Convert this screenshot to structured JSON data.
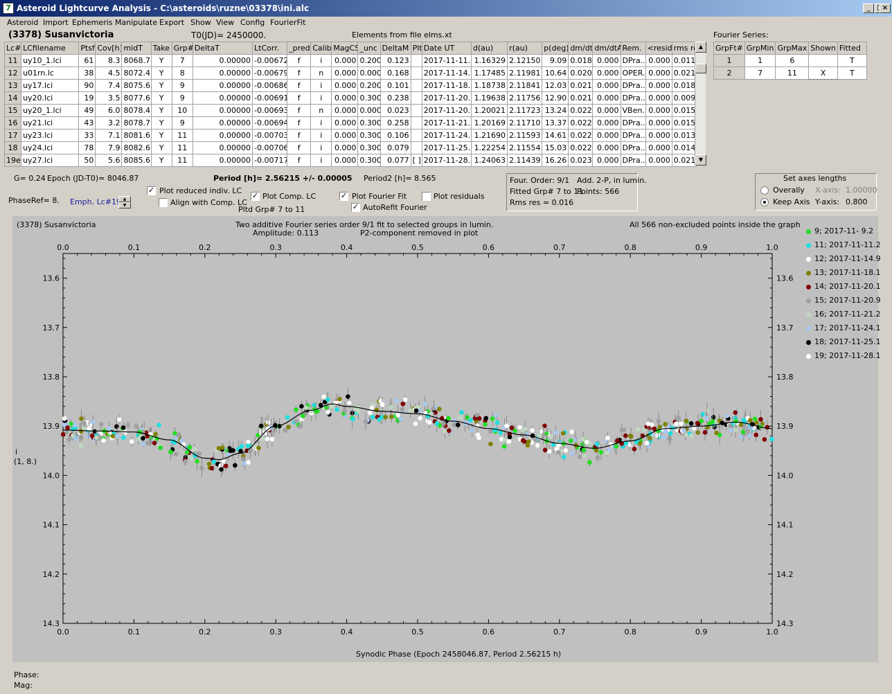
{
  "window": {
    "title": "Asteroid Lightcurve Analysis - C:\\asteroids\\ruzne\\03378\\ini.alc",
    "min_label": "_",
    "max_label": "□",
    "close_label": "×"
  },
  "menu": [
    "Asteroid",
    "Import",
    "Ephemeris",
    "Manipulate",
    "Export",
    "Show",
    "View",
    "Config",
    "FourierFit"
  ],
  "header": {
    "asteroid_name": "(3378) Susanvictoria",
    "t0": "T0(JD)= 2450000.",
    "elements_source": "Elements from file elms.xt",
    "fourier_series_label": "Fourier Series:"
  },
  "lc_table": {
    "columns": [
      "Lc#",
      "LCfilename",
      "Ptsf",
      "Cov[h]",
      "midT",
      "Take",
      "Grp#",
      "DeltaT",
      "LtCorr.",
      "_pred.",
      "Calib.",
      "MagCS",
      "_unc",
      "DeltaM",
      "Plt",
      "Date UT",
      "d(au)",
      "r(au)",
      "p(deg)",
      "dm/dt",
      "dm/dtA",
      "Rem.",
      "<resid>",
      "rms res"
    ],
    "rows": [
      [
        "11",
        "uy10_1.lci",
        "61",
        "8.3",
        "8068.7",
        "Y",
        "7",
        "0.00000",
        "-0.00672",
        "f",
        "i",
        "0.000",
        "0.200",
        "0.123",
        "",
        "2017-11-11.2",
        "1.16329",
        "2.12150",
        "9.09",
        "0.018",
        "0.000",
        "DPra...",
        "0.000",
        "0.011"
      ],
      [
        "12",
        "u01rn.lc",
        "38",
        "4.5",
        "8072.4",
        "Y",
        "8",
        "0.00000",
        "-0.00679",
        "f",
        "n",
        "0.000",
        "0.000",
        "0.168",
        "",
        "2017-11-14.9",
        "1.17485",
        "2.11981",
        "10.64",
        "0.020",
        "0.000",
        "OPER...",
        "0.000",
        "0.021"
      ],
      [
        "13",
        "uy17.lci",
        "90",
        "7.4",
        "8075.6",
        "Y",
        "9",
        "0.00000",
        "-0.00686",
        "f",
        "i",
        "0.000",
        "0.200",
        "0.101",
        "",
        "2017-11-18.1",
        "1.18738",
        "2.11841",
        "12.03",
        "0.021",
        "0.000",
        "DPra...",
        "0.000",
        "0.018"
      ],
      [
        "14",
        "uy20.lci",
        "19",
        "3.5",
        "8077.6",
        "Y",
        "9",
        "0.00000",
        "-0.00691",
        "f",
        "i",
        "0.000",
        "0.300",
        "0.238",
        "",
        "2017-11-20.1",
        "1.19638",
        "2.11756",
        "12.90",
        "0.021",
        "0.000",
        "DPra...",
        "0.000",
        "0.009"
      ],
      [
        "15",
        "uy20_1.lci",
        "49",
        "6.0",
        "8078.4",
        "Y",
        "10",
        "0.00000",
        "-0.00693",
        "f",
        "n",
        "0.000",
        "0.000",
        "0.023",
        "",
        "2017-11-20.9",
        "1.20021",
        "2.11723",
        "13.24",
        "0.022",
        "0.000",
        "VBen...",
        "0.000",
        "0.015"
      ],
      [
        "16",
        "uy21.lci",
        "43",
        "3.2",
        "8078.7",
        "Y",
        "9",
        "0.00000",
        "-0.00694",
        "f",
        "i",
        "0.000",
        "0.300",
        "0.258",
        "",
        "2017-11-21.2",
        "1.20169",
        "2.11710",
        "13.37",
        "0.022",
        "0.000",
        "DPra...",
        "0.000",
        "0.015"
      ],
      [
        "17",
        "uy23.lci",
        "33",
        "7.1",
        "8081.6",
        "Y",
        "11",
        "0.00000",
        "-0.00703",
        "f",
        "i",
        "0.000",
        "0.300",
        "0.106",
        "",
        "2017-11-24.1",
        "1.21690",
        "2.11593",
        "14.61",
        "0.022",
        "0.000",
        "DPra...",
        "0.000",
        "0.013"
      ],
      [
        "18",
        "uy24.lci",
        "78",
        "7.9",
        "8082.6",
        "Y",
        "11",
        "0.00000",
        "-0.00706",
        "f",
        "i",
        "0.000",
        "0.300",
        "0.079",
        "",
        "2017-11-25.1",
        "1.22254",
        "2.11554",
        "15.03",
        "0.022",
        "0.000",
        "DPra...",
        "0.000",
        "0.014"
      ],
      [
        "19e",
        "uy27.lci",
        "50",
        "5.6",
        "8085.6",
        "Y",
        "11",
        "0.00000",
        "-0.00717",
        "f",
        "i",
        "0.000",
        "0.300",
        "0.077",
        "[ ]",
        "2017-11-28.1",
        "1.24063",
        "2.11439",
        "16.26",
        "0.023",
        "0.000",
        "DPra...",
        "0.000",
        "0.021"
      ]
    ]
  },
  "fourier_table": {
    "columns": [
      "GrpFt#",
      "GrpMin",
      "GrpMax",
      "Shown",
      "Fitted"
    ],
    "rows": [
      [
        "1",
        "1",
        "6",
        "",
        "T"
      ],
      [
        "2",
        "7",
        "11",
        "X",
        "T"
      ]
    ]
  },
  "controls": {
    "g_value": "G= 0.24",
    "epoch": "Epoch (JD-T0)= 8046.87",
    "period": "Period [h]= 2.56215 +/- 0.00005",
    "period2": "Period2 [h]= 8.565",
    "phase_ref": "PhaseRef= 8.",
    "emph_lc": "Emph. Lc#19:",
    "plot_reduced": "Plot reduced indiv. LC",
    "align_comp": "Align with Comp. LC",
    "plot_comp": "Plot Comp. LC",
    "pltd_grp": "Pltd Grp#  7   to   11",
    "plot_fourier": "Plot Fourier Fit",
    "autorefit": "AutoRefit Fourier",
    "plot_residuals": "Plot residuals",
    "check_mark": "✓",
    "info_order": "Four. Order:  9/1",
    "info_add": "Add. 2-P, in lumin.",
    "info_fitted": "Fitted Grp# 7 to 11",
    "info_points": "Points: 566",
    "info_rms": "Rms res      = 0.016",
    "axes_title": "Set axes lengths",
    "overally": "Overally",
    "keep_axis": "Keep Axis",
    "x_axis_label": "X-axis:",
    "x_axis_value": "1.00000",
    "y_axis_label": "Y-axis:",
    "y_axis_value": "0.800"
  },
  "plot": {
    "name_label": "(3378) Susanvictoria",
    "caption1": "Two additive Fourier series order 9/1 fit to selected groups in lumin.",
    "caption2": "Amplitude: 0.113",
    "caption3": "P2-component removed in plot",
    "caption_right": "All 566 non-excluded points inside the graph",
    "ylabel1": "i",
    "ylabel2": "(1, 8.)",
    "xlabel": "Synodic Phase (Epoch 2458046.87, Period 2.56215 h)"
  },
  "status": {
    "phase_label": "Phase:",
    "mag_label": "Mag:"
  },
  "chart_data": {
    "type": "scatter",
    "title": "Two additive Fourier series order 9/1 fit to selected groups in lumin.",
    "xlabel": "Synodic Phase (Epoch 2458046.87, Period 2.56215 h)",
    "ylabel": "i (1, 8.)",
    "xlim": [
      0.0,
      1.0
    ],
    "ylim": [
      14.3,
      13.55
    ],
    "y_inverted": true,
    "xticks": [
      "0.0",
      "0.1",
      "0.2",
      "0.3",
      "0.4",
      "0.5",
      "0.6",
      "0.7",
      "0.8",
      "0.9",
      "1.0"
    ],
    "yticks": [
      "13.6",
      "13.7",
      "13.8",
      "13.9",
      "14.0",
      "14.1",
      "14.2",
      "14.3"
    ],
    "ytick_values": [
      13.6,
      13.7,
      13.8,
      13.9,
      14.0,
      14.1,
      14.2,
      14.3
    ],
    "fit_curve": {
      "name": "Fourier fit",
      "x": [
        0.0,
        0.05,
        0.1,
        0.15,
        0.2,
        0.22,
        0.25,
        0.3,
        0.35,
        0.38,
        0.4,
        0.45,
        0.5,
        0.55,
        0.6,
        0.65,
        0.7,
        0.75,
        0.8,
        0.85,
        0.9,
        0.95,
        1.0
      ],
      "y": [
        13.908,
        13.91,
        13.912,
        13.928,
        13.965,
        13.968,
        13.955,
        13.9,
        13.868,
        13.855,
        13.86,
        13.87,
        13.875,
        13.89,
        13.905,
        13.918,
        13.935,
        13.945,
        13.93,
        13.905,
        13.9,
        13.892,
        13.905
      ]
    },
    "series": [
      {
        "name": "9; 2017-11- 9.2",
        "color": "#22dd22"
      },
      {
        "name": "11; 2017-11-11.2",
        "color": "#22dddd"
      },
      {
        "name": "12; 2017-11-14.9",
        "color": "#ffffff"
      },
      {
        "name": "13; 2017-11-18.1",
        "color": "#808000"
      },
      {
        "name": "14; 2017-11-20.1",
        "color": "#800000"
      },
      {
        "name": "15; 2017-11-20.9",
        "color": "#a0a0a0"
      },
      {
        "name": "16; 2017-11-21.2",
        "color": "#c0d8c0"
      },
      {
        "name": "17; 2017-11-24.1",
        "color": "#a8c8f0"
      },
      {
        "name": "18; 2017-11-25.1",
        "color": "#000000"
      },
      {
        "name": "19; 2017-11-28.1",
        "color": "#ffffff"
      }
    ],
    "points_total": 566,
    "scatter_sigma": 0.022,
    "grid": false
  }
}
